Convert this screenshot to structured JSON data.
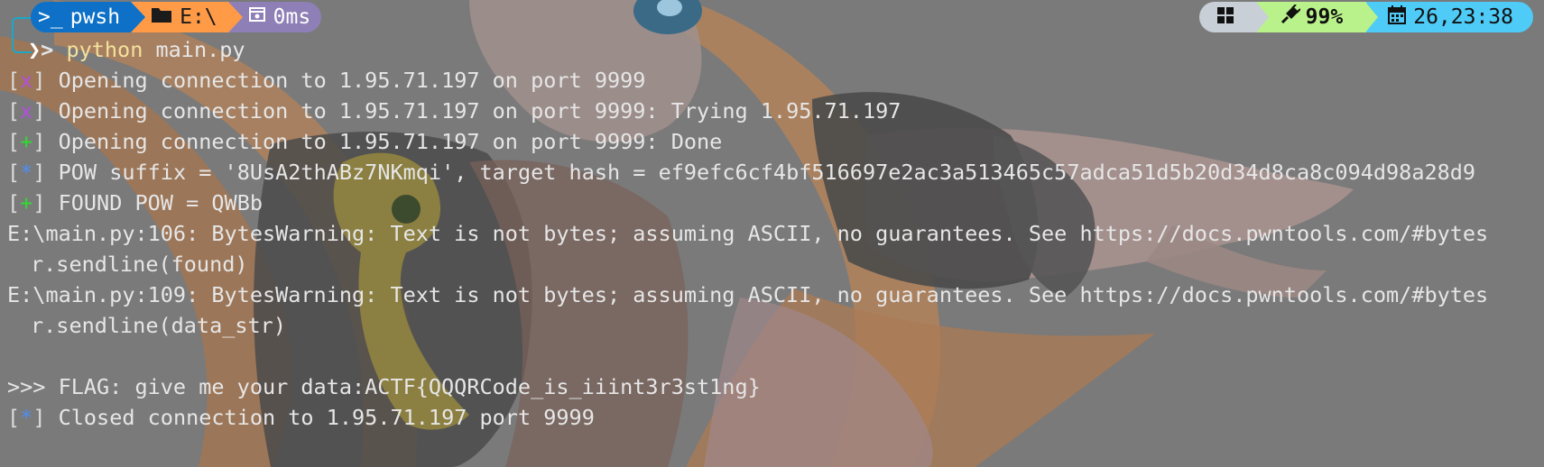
{
  "prompt": {
    "shell": {
      "icon": "terminal-icon",
      "label": "pwsh"
    },
    "path": {
      "icon": "folder-icon",
      "label": "E:\\"
    },
    "time": {
      "icon": "timer-icon",
      "label": "0ms"
    },
    "os": {
      "icon": "windows-icon"
    },
    "battery": {
      "icon": "plug-icon",
      "label": "99%"
    },
    "date": {
      "icon": "calendar-icon",
      "label": "26,23:38"
    },
    "command": {
      "glyph": ">",
      "program": "python",
      "args": "main.py"
    }
  },
  "colors": {
    "shell_bg": "#0e71c7",
    "path_bg": "#ff9a47",
    "time_bg": "#8e7fb6",
    "os_bg": "#c9cfd6",
    "battery_bg": "#b9f28a",
    "date_bg": "#4ecbf6",
    "tag_x": "#b14fe0",
    "tag_plus": "#2edc2e",
    "tag_star": "#4f8ef0"
  },
  "output": [
    {
      "type": "tag",
      "tag": "x",
      "text": " Opening connection to 1.95.71.197 on port 9999"
    },
    {
      "type": "tag",
      "tag": "x",
      "text": " Opening connection to 1.95.71.197 on port 9999: Trying 1.95.71.197"
    },
    {
      "type": "tag",
      "tag": "+",
      "text": " Opening connection to 1.95.71.197 on port 9999: Done"
    },
    {
      "type": "tag",
      "tag": "*",
      "text": " POW suffix = '8UsA2thABz7NKmqi', target hash = ef9efc6cf4bf516697e2ac3a513465c57adca51d5b20d34d8ca8c094d98a28d9"
    },
    {
      "type": "tag",
      "tag": "+",
      "text": " FOUND POW = QWBb"
    },
    {
      "type": "plain",
      "text": "E:\\main.py:106: BytesWarning: Text is not bytes; assuming ASCII, no guarantees. See https://docs.pwntools.com/#bytes"
    },
    {
      "type": "indent",
      "text": "r.sendline(found)"
    },
    {
      "type": "plain",
      "text": "E:\\main.py:109: BytesWarning: Text is not bytes; assuming ASCII, no guarantees. See https://docs.pwntools.com/#bytes"
    },
    {
      "type": "indent",
      "text": "r.sendline(data_str)"
    },
    {
      "type": "blank",
      "text": ""
    },
    {
      "type": "plain",
      "text": ">>> FLAG: give me your data:ACTF{QQQRCode_is_iiint3r3st1ng}"
    },
    {
      "type": "tag",
      "tag": "*",
      "text": " Closed connection to 1.95.71.197 port 9999"
    }
  ]
}
